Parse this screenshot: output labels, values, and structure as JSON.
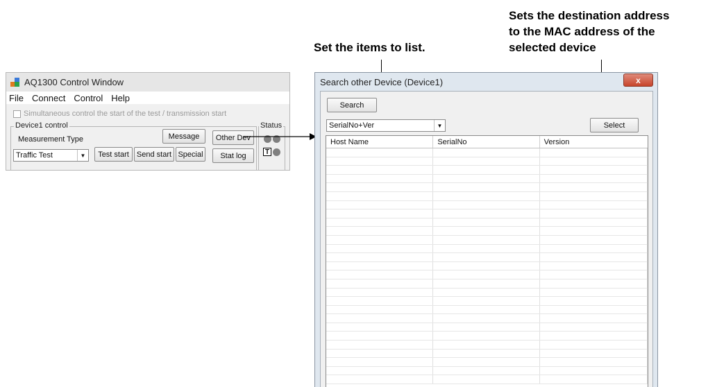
{
  "annotations": {
    "select_note_line1": "Sets the destination address",
    "select_note_line2": "to the MAC address of the",
    "select_note_line3": "selected device",
    "list_note": "Set the items to list."
  },
  "control_window": {
    "title": "AQ1300 Control Window",
    "menu": [
      "File",
      "Connect",
      "Control",
      "Help"
    ],
    "simultaneous_label": "Simultaneous control the start of the test / transmission start",
    "device_group_label": "Device1 control",
    "measurement_type_label": "Measurement Type",
    "measurement_type_value": "Traffic Test",
    "buttons": {
      "message": "Message",
      "test_start": "Test start",
      "send_start": "Send start",
      "special": "Special",
      "other_dev": "Other Dev",
      "stat_log": "Stat log"
    },
    "status_label": "Status",
    "t_indicator": "T"
  },
  "dialog": {
    "title": "Search other Device (Device1)",
    "close_glyph": "x",
    "search_button": "Search",
    "list_type_value": "SerialNo+Ver",
    "select_button": "Select",
    "columns": [
      "Host Name",
      "SerialNo",
      "Version"
    ]
  },
  "colors": {
    "accent_window": "#f0f0f0",
    "dialog_frame": "#dfe7ef",
    "close_button": "#c7442b"
  }
}
